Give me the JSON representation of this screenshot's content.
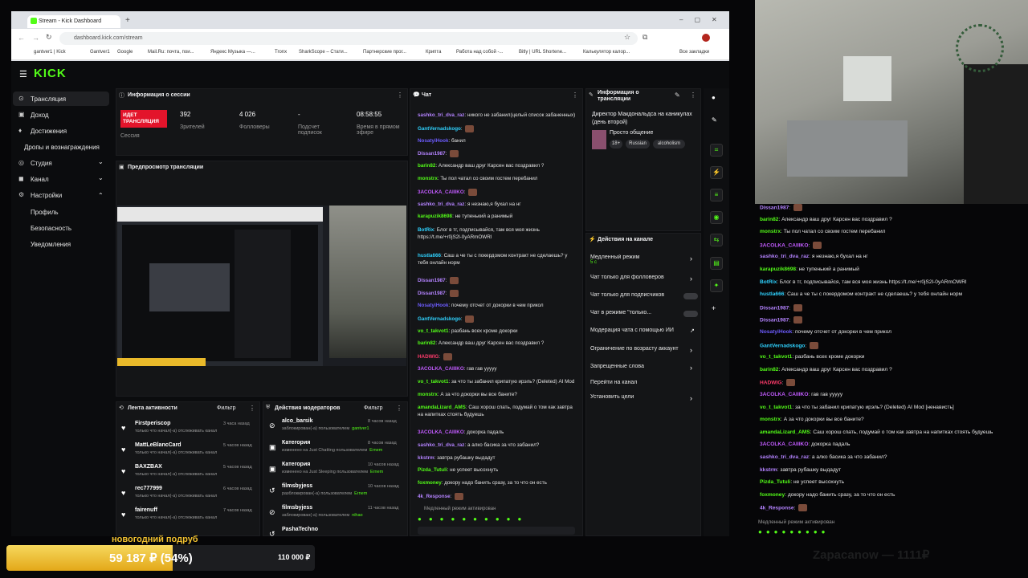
{
  "browser": {
    "tab_title": "Stream - Kick Dashboard",
    "url": "dashboard.kick.com/stream",
    "bookmarks": [
      "gantver1 | Kick",
      "Gantver1",
      "Google",
      "Mail.Ru: почта, пои...",
      "Яндекс Музыка —...",
      "Tronx",
      "SharkScope – Стати...",
      "Партнерские прог...",
      "Крипта",
      "Работа над собой -...",
      "Bitly | URL Shortene...",
      "Калькулятор калор...",
      "Все закладки"
    ]
  },
  "sidebar": {
    "logo": "KICK",
    "items": [
      "Трансляция",
      "Доход",
      "Достижения",
      "Дропы и вознаграждения",
      "Студия",
      "Канал",
      "Настройки",
      "Профиль",
      "Безопасность",
      "Уведомления"
    ]
  },
  "session": {
    "title": "Информация о сессии",
    "live_badge": "ИДЕТ ТРАНСЛЯЦИЯ",
    "session_label": "Сессия",
    "viewers": "392",
    "viewers_label": "Зрителей",
    "followers": "4 026",
    "followers_label": "Фолловеры",
    "subs": "-",
    "subs_label": "Подсчет подписок",
    "time": "08:58:55",
    "time_label": "Время в прямом эфире"
  },
  "preview": {
    "title": "Предпросмотр трансляции"
  },
  "activity": {
    "title": "Лента активности",
    "filter": "Фильтр",
    "items": [
      {
        "name": "Firstperiscop",
        "time": "3 часа назад",
        "text": "только что начал(-а) отслеживать канал"
      },
      {
        "name": "MattLeBlancCard",
        "time": "5 часов назад",
        "text": "только что начал(-а) отслеживать канал"
      },
      {
        "name": "BAXZBAX",
        "time": "5 часов назад",
        "text": "только что начал(-а) отслеживать канал"
      },
      {
        "name": "rec777999",
        "time": "6 часов назад",
        "text": "только что начал(-а) отслеживать канал"
      },
      {
        "name": "fairenuff",
        "time": "7 часов назад",
        "text": "только что начал(-а) отслеживать канал"
      }
    ]
  },
  "modactions": {
    "title": "Действия модераторов",
    "filter": "Фильтр",
    "items": [
      {
        "name": "alco_barsik",
        "time": "8 часов назад",
        "text": "заблокирован(-а) пользователем",
        "actor": "gantver1"
      },
      {
        "name": "Категория",
        "time": "8 часов назад",
        "text": "изменено на Just Chatting пользователем",
        "actor": "Ernem"
      },
      {
        "name": "Категория",
        "time": "10 часов назад",
        "text": "изменено на Just Sleeping пользователем",
        "actor": "Ernem"
      },
      {
        "name": "filmsbyjess",
        "time": "10 часов назад",
        "text": "разблокирован(-а) пользователем",
        "actor": "Ernem"
      },
      {
        "name": "filmsbyjess",
        "time": "11 часов назад",
        "text": "заблокирован(-а) пользователем",
        "actor": "nihao"
      },
      {
        "name": "PashaTechno",
        "time": "",
        "text": "",
        "actor": ""
      }
    ]
  },
  "chat": {
    "title": "Чат",
    "slow_notice": "Медленный режим активирован",
    "lines": [
      {
        "user": "sashko_tri_dva_raz",
        "color": "#b483ff",
        "text": "никого не забанил(целый список забаненных)"
      },
      {
        "user": "GantVernadskogo",
        "color": "#2fd2ff",
        "text": ""
      },
      {
        "user": "NosatyiHook",
        "color": "#6d5cff",
        "text": "банил"
      },
      {
        "user": "Dissan1987",
        "color": "#b483ff",
        "text": ""
      },
      {
        "user": "barin82",
        "color": "#53fc18",
        "text": "Александр ваш друг Карсен вас поздравил ?"
      },
      {
        "user": "monstrx",
        "color": "#53fc18",
        "text": "Ты пол чатал со своим гостем перебанил"
      },
      {
        "user": "3ACOLKA_CAIIIKO",
        "color": "#c25bff",
        "text": ""
      },
      {
        "user": "sashko_tri_dva_raz",
        "color": "#b483ff",
        "text": "я незнаю,я бухал на нг"
      },
      {
        "user": "karapuzik8698",
        "color": "#53fc18",
        "text": "не тупенький а ранимый"
      },
      {
        "user": "BotRix",
        "color": "#2fd2ff",
        "text": "Блог в тг, подписывайся, там вся моя жизнь https://t.me/+r0jS2l-0yARmOWRl"
      },
      {
        "user": "hustla666",
        "color": "#2fd2ff",
        "text": "Саш а че ты с покердомом контракт не сделаешь? у тебя онлайн норм"
      },
      {
        "user": "Dissan1987",
        "color": "#b483ff",
        "text": ""
      },
      {
        "user": "Dissan1987",
        "color": "#b483ff",
        "text": ""
      },
      {
        "user": "NosatyiHook",
        "color": "#6d5cff",
        "text": "почему отсчет от докорки в чем прикол"
      },
      {
        "user": "GantVernadskogo",
        "color": "#2fd2ff",
        "text": ""
      },
      {
        "user": "vo_t_takvot1",
        "color": "#53fc18",
        "text": "разбань всех кроме докорки"
      },
      {
        "user": "barin82",
        "color": "#53fc18",
        "text": "Александр ваш друг Карсен вас поздравил ?"
      },
      {
        "user": "HADWIG",
        "color": "#ff3b6b",
        "text": ""
      },
      {
        "user": "3ACOLKA_CAIIIKO",
        "color": "#c25bff",
        "text": "гав гав уууyy"
      },
      {
        "user": "vo_t_takvot1",
        "color": "#53fc18",
        "text": "за что ты забанил крипатую ирэль? (Deleted) AI Mod"
      },
      {
        "user": "monstrx",
        "color": "#53fc18",
        "text": "А за что докорки вы все баните?"
      },
      {
        "user": "amandaLizard_AMS",
        "color": "#53fc18",
        "text": "Саш хорош спать, подумай о том как завтра на напитках стоять будуешь"
      },
      {
        "user": "3ACOLKA_CAIIIKO",
        "color": "#c25bff",
        "text": "докорка падаль"
      },
      {
        "user": "sashko_tri_dva_raz",
        "color": "#b483ff",
        "text": "а алко басика за что забанил?"
      },
      {
        "user": "kkstrm",
        "color": "#b483ff",
        "text": "завтра рубашку выдадут"
      },
      {
        "user": "Pizda_Tutuli",
        "color": "#53fc18",
        "text": "не успеет высохнуть"
      },
      {
        "user": "foxmoney",
        "color": "#53fc18",
        "text": "докору надо банить сразу, за то что он есть"
      },
      {
        "user": "4k_Response",
        "color": "#b483ff",
        "text": ""
      }
    ]
  },
  "stream_info": {
    "title": "Информация о трансляции",
    "stream_title": "Директор Макдональдса на каникулах (день второй)",
    "category": "Просто общение",
    "tags": [
      "18+",
      "Russian",
      "alcoholism"
    ]
  },
  "channel_actions": {
    "title": "Действия на канале",
    "items": [
      {
        "label": "Медленный режим",
        "sub": "5 с",
        "control": "arrow"
      },
      {
        "label": "Чат только для фолловеров",
        "sub": "",
        "control": "arrow"
      },
      {
        "label": "Чат только для подписчиков",
        "sub": "",
        "control": "toggle"
      },
      {
        "label": "Чат в режиме \"только...",
        "sub": "",
        "control": "toggle"
      },
      {
        "label": "Модерация чата с помощью ИИ",
        "sub": "",
        "control": "ext"
      },
      {
        "label": "Ограничение по возрасту аккаунт",
        "sub": "",
        "control": "arrow"
      },
      {
        "label": "Запрещенные слова",
        "sub": "",
        "control": "arrow"
      },
      {
        "label": "Перейти на канал",
        "sub": "",
        "control": "none"
      },
      {
        "label": "Установить цели",
        "sub": "",
        "control": "arrow"
      }
    ]
  },
  "overlay_chat": {
    "slow_notice": "Медленный режим активирован",
    "lines": [
      {
        "user": "Dissan1987",
        "color": "#b483ff",
        "text": ""
      },
      {
        "user": "barin82",
        "color": "#53fc18",
        "text": "Александр ваш друг Карсен вас поздравил ?"
      },
      {
        "user": "monstrx",
        "color": "#53fc18",
        "text": "Ты пол чатал со своим гостем перебанил"
      },
      {
        "user": "3ACOLKA_CAIIIKO",
        "color": "#c25bff",
        "text": ""
      },
      {
        "user": "sashko_tri_dva_raz",
        "color": "#b483ff",
        "text": "я незнаю,я бухал на нг"
      },
      {
        "user": "karapuzik8698",
        "color": "#53fc18",
        "text": "не тупенький а ранимый"
      },
      {
        "user": "BotRix",
        "color": "#2fd2ff",
        "text": "Блог в тг, подписывайся, там вся моя жизнь https://t.me/+r0jS2l-0yARmOWRl"
      },
      {
        "user": "hustla666",
        "color": "#2fd2ff",
        "text": "Саш а че ты с покердомом контракт не сделаешь? у тебя онлайн норм"
      },
      {
        "user": "Dissan1987",
        "color": "#b483ff",
        "text": ""
      },
      {
        "user": "Dissan1987",
        "color": "#b483ff",
        "text": ""
      },
      {
        "user": "NosatyiHook",
        "color": "#6d5cff",
        "text": "почему отсчет от докорки в чем прикол"
      },
      {
        "user": "GantVernadskogo",
        "color": "#2fd2ff",
        "text": ""
      },
      {
        "user": "vo_t_takvot1",
        "color": "#53fc18",
        "text": "разбань всех кроме докорки"
      },
      {
        "user": "barin82",
        "color": "#53fc18",
        "text": "Александр ваш друг Карсен вас поздравил ?"
      },
      {
        "user": "HADWIG",
        "color": "#ff3b6b",
        "text": ""
      },
      {
        "user": "3ACOLKA_CAIIIKO",
        "color": "#c25bff",
        "text": "гав гав уууyy"
      },
      {
        "user": "vo_t_takvot1",
        "color": "#53fc18",
        "text": "за что ты забанил крипатую ирэль? (Deleted) AI Mod [ненависть]"
      },
      {
        "user": "monstrx",
        "color": "#53fc18",
        "text": "А за что докорки вы все баните?"
      },
      {
        "user": "amandaLizard_AMS",
        "color": "#53fc18",
        "text": "Саш хорош спать, подумай о том как завтра на напитках стоять будуешь"
      },
      {
        "user": "3ACOLKA_CAIIIKO",
        "color": "#c25bff",
        "text": "докорка падаль"
      },
      {
        "user": "sashko_tri_dva_raz",
        "color": "#b483ff",
        "text": "а алко басика за что забанил?"
      },
      {
        "user": "kkstrm",
        "color": "#b483ff",
        "text": "завтра рубашку выдадут"
      },
      {
        "user": "Pizda_Tutuli",
        "color": "#53fc18",
        "text": "не успеет высохнуть"
      },
      {
        "user": "foxmoney",
        "color": "#53fc18",
        "text": "докору надо банить сразу, за то что он есть"
      },
      {
        "user": "4k_Response",
        "color": "#b483ff",
        "text": ""
      }
    ]
  },
  "goal": {
    "title": "новогодний подруб",
    "current": "59 187 ₽ (54%)",
    "target": "110 000 ₽",
    "progress": 0.54
  },
  "watermark": "Zapacanow — 1111₽"
}
